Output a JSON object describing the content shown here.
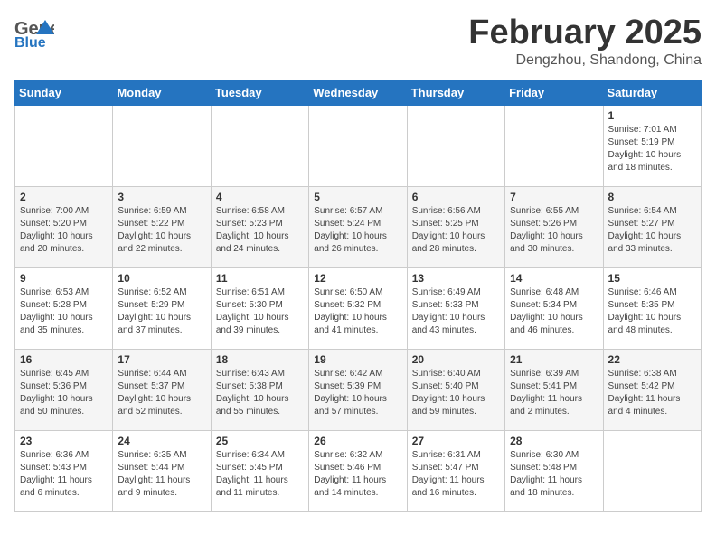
{
  "header": {
    "logo": {
      "general": "General",
      "blue": "Blue",
      "tagline": ""
    },
    "title": "February 2025",
    "location": "Dengzhou, Shandong, China"
  },
  "weekdays": [
    "Sunday",
    "Monday",
    "Tuesday",
    "Wednesday",
    "Thursday",
    "Friday",
    "Saturday"
  ],
  "weeks": [
    [
      {
        "day": "",
        "info": ""
      },
      {
        "day": "",
        "info": ""
      },
      {
        "day": "",
        "info": ""
      },
      {
        "day": "",
        "info": ""
      },
      {
        "day": "",
        "info": ""
      },
      {
        "day": "",
        "info": ""
      },
      {
        "day": "1",
        "info": "Sunrise: 7:01 AM\nSunset: 5:19 PM\nDaylight: 10 hours\nand 18 minutes."
      }
    ],
    [
      {
        "day": "2",
        "info": "Sunrise: 7:00 AM\nSunset: 5:20 PM\nDaylight: 10 hours\nand 20 minutes."
      },
      {
        "day": "3",
        "info": "Sunrise: 6:59 AM\nSunset: 5:22 PM\nDaylight: 10 hours\nand 22 minutes."
      },
      {
        "day": "4",
        "info": "Sunrise: 6:58 AM\nSunset: 5:23 PM\nDaylight: 10 hours\nand 24 minutes."
      },
      {
        "day": "5",
        "info": "Sunrise: 6:57 AM\nSunset: 5:24 PM\nDaylight: 10 hours\nand 26 minutes."
      },
      {
        "day": "6",
        "info": "Sunrise: 6:56 AM\nSunset: 5:25 PM\nDaylight: 10 hours\nand 28 minutes."
      },
      {
        "day": "7",
        "info": "Sunrise: 6:55 AM\nSunset: 5:26 PM\nDaylight: 10 hours\nand 30 minutes."
      },
      {
        "day": "8",
        "info": "Sunrise: 6:54 AM\nSunset: 5:27 PM\nDaylight: 10 hours\nand 33 minutes."
      }
    ],
    [
      {
        "day": "9",
        "info": "Sunrise: 6:53 AM\nSunset: 5:28 PM\nDaylight: 10 hours\nand 35 minutes."
      },
      {
        "day": "10",
        "info": "Sunrise: 6:52 AM\nSunset: 5:29 PM\nDaylight: 10 hours\nand 37 minutes."
      },
      {
        "day": "11",
        "info": "Sunrise: 6:51 AM\nSunset: 5:30 PM\nDaylight: 10 hours\nand 39 minutes."
      },
      {
        "day": "12",
        "info": "Sunrise: 6:50 AM\nSunset: 5:32 PM\nDaylight: 10 hours\nand 41 minutes."
      },
      {
        "day": "13",
        "info": "Sunrise: 6:49 AM\nSunset: 5:33 PM\nDaylight: 10 hours\nand 43 minutes."
      },
      {
        "day": "14",
        "info": "Sunrise: 6:48 AM\nSunset: 5:34 PM\nDaylight: 10 hours\nand 46 minutes."
      },
      {
        "day": "15",
        "info": "Sunrise: 6:46 AM\nSunset: 5:35 PM\nDaylight: 10 hours\nand 48 minutes."
      }
    ],
    [
      {
        "day": "16",
        "info": "Sunrise: 6:45 AM\nSunset: 5:36 PM\nDaylight: 10 hours\nand 50 minutes."
      },
      {
        "day": "17",
        "info": "Sunrise: 6:44 AM\nSunset: 5:37 PM\nDaylight: 10 hours\nand 52 minutes."
      },
      {
        "day": "18",
        "info": "Sunrise: 6:43 AM\nSunset: 5:38 PM\nDaylight: 10 hours\nand 55 minutes."
      },
      {
        "day": "19",
        "info": "Sunrise: 6:42 AM\nSunset: 5:39 PM\nDaylight: 10 hours\nand 57 minutes."
      },
      {
        "day": "20",
        "info": "Sunrise: 6:40 AM\nSunset: 5:40 PM\nDaylight: 10 hours\nand 59 minutes."
      },
      {
        "day": "21",
        "info": "Sunrise: 6:39 AM\nSunset: 5:41 PM\nDaylight: 11 hours\nand 2 minutes."
      },
      {
        "day": "22",
        "info": "Sunrise: 6:38 AM\nSunset: 5:42 PM\nDaylight: 11 hours\nand 4 minutes."
      }
    ],
    [
      {
        "day": "23",
        "info": "Sunrise: 6:36 AM\nSunset: 5:43 PM\nDaylight: 11 hours\nand 6 minutes."
      },
      {
        "day": "24",
        "info": "Sunrise: 6:35 AM\nSunset: 5:44 PM\nDaylight: 11 hours\nand 9 minutes."
      },
      {
        "day": "25",
        "info": "Sunrise: 6:34 AM\nSunset: 5:45 PM\nDaylight: 11 hours\nand 11 minutes."
      },
      {
        "day": "26",
        "info": "Sunrise: 6:32 AM\nSunset: 5:46 PM\nDaylight: 11 hours\nand 14 minutes."
      },
      {
        "day": "27",
        "info": "Sunrise: 6:31 AM\nSunset: 5:47 PM\nDaylight: 11 hours\nand 16 minutes."
      },
      {
        "day": "28",
        "info": "Sunrise: 6:30 AM\nSunset: 5:48 PM\nDaylight: 11 hours\nand 18 minutes."
      },
      {
        "day": "",
        "info": ""
      }
    ]
  ]
}
